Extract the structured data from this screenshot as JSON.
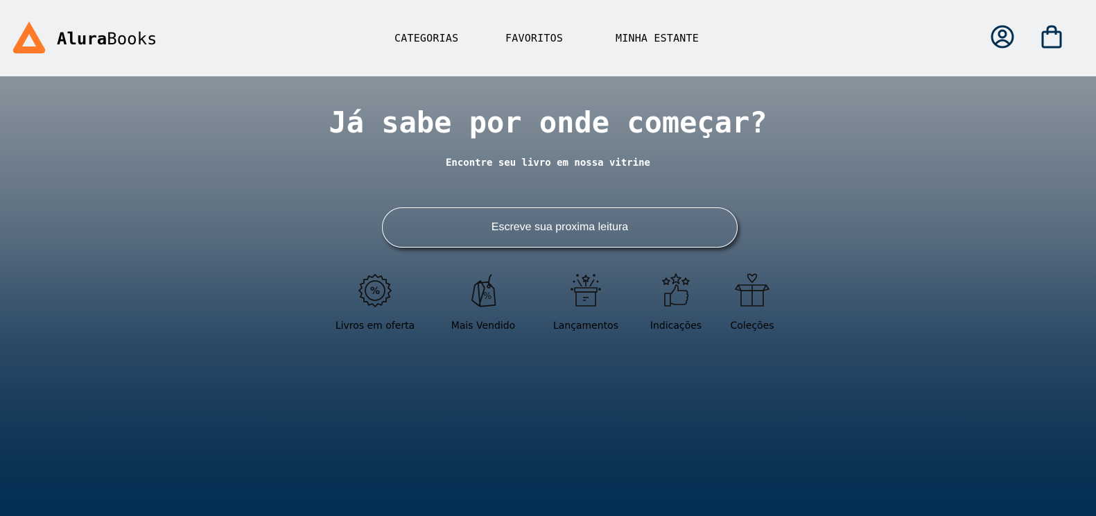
{
  "header": {
    "logo": {
      "brand_bold": "Alura",
      "brand_rest": "Books",
      "icon": "triangle-logo-icon",
      "color": "#ff7a28"
    },
    "nav": [
      {
        "label": "CATEGORIAS"
      },
      {
        "label": "FAVORITOS"
      },
      {
        "label": "MINHA ESTANTE"
      }
    ],
    "icons": {
      "profile": "user-circle-icon",
      "cart": "shopping-bag-icon",
      "color": "#002f52"
    }
  },
  "hero": {
    "title": "Já sabe por onde começar?",
    "subtitle": "Encontre seu livro em nossa vitrine",
    "search": {
      "placeholder": "Escreve sua proxima leitura",
      "value": ""
    }
  },
  "categories": [
    {
      "label": "Livros em oferta",
      "icon": "discount-badge-icon"
    },
    {
      "label": "Mais Vendido",
      "icon": "price-tag-percent-icon"
    },
    {
      "label": "Lançamentos",
      "icon": "gift-box-stars-icon"
    },
    {
      "label": "Indicações",
      "icon": "thumbs-up-stars-icon"
    },
    {
      "label": "Coleções",
      "icon": "gift-box-heart-icon"
    }
  ],
  "colors": {
    "header_bg": "#f0f1f2",
    "hero_bottom": "#002f52",
    "hero_top": "#8a949d"
  }
}
